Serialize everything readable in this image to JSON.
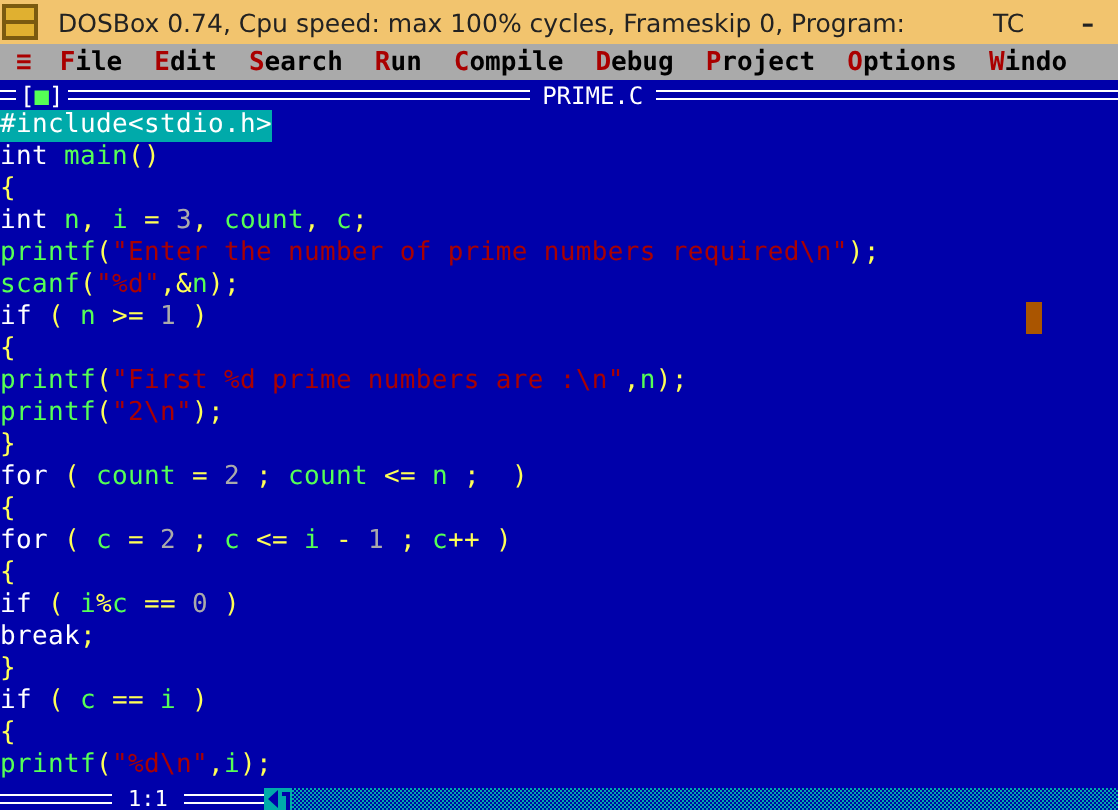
{
  "window": {
    "title": "DOSBox 0.74, Cpu speed: max 100% cycles, Frameskip  0, Program:",
    "program": "TC",
    "minimize": "–"
  },
  "menu": {
    "system": "≡",
    "items": [
      "File",
      "Edit",
      "Search",
      "Run",
      "Compile",
      "Debug",
      "Project",
      "Options",
      "Windo"
    ]
  },
  "editor": {
    "close_box": "[■]",
    "title": "PRIME.C",
    "lines": [
      {
        "selected": true,
        "tokens": [
          {
            "kind": "pre",
            "text": "#include<stdio.h>"
          }
        ]
      },
      {
        "selected": false,
        "tokens": [
          {
            "kind": "kw",
            "text": "int "
          },
          {
            "kind": "id",
            "text": "main"
          },
          {
            "kind": "pu",
            "text": "()"
          }
        ]
      },
      {
        "selected": false,
        "tokens": [
          {
            "kind": "pu",
            "text": "{"
          }
        ]
      },
      {
        "selected": false,
        "tokens": [
          {
            "kind": "kw",
            "text": "int "
          },
          {
            "kind": "id",
            "text": "n"
          },
          {
            "kind": "pu",
            "text": ", "
          },
          {
            "kind": "id",
            "text": "i "
          },
          {
            "kind": "pu",
            "text": "= "
          },
          {
            "kind": "num",
            "text": "3"
          },
          {
            "kind": "pu",
            "text": ", "
          },
          {
            "kind": "id",
            "text": "count"
          },
          {
            "kind": "pu",
            "text": ", "
          },
          {
            "kind": "id",
            "text": "c"
          },
          {
            "kind": "pu",
            "text": ";"
          }
        ]
      },
      {
        "selected": false,
        "tokens": [
          {
            "kind": "id",
            "text": "printf"
          },
          {
            "kind": "pu",
            "text": "("
          },
          {
            "kind": "str",
            "text": "\"Enter the number of prime numbers required\\n\""
          },
          {
            "kind": "pu",
            "text": ");"
          }
        ]
      },
      {
        "selected": false,
        "tokens": [
          {
            "kind": "id",
            "text": "scanf"
          },
          {
            "kind": "pu",
            "text": "("
          },
          {
            "kind": "str",
            "text": "\"%d\""
          },
          {
            "kind": "pu",
            "text": ",&"
          },
          {
            "kind": "id",
            "text": "n"
          },
          {
            "kind": "pu",
            "text": ");"
          }
        ]
      },
      {
        "selected": false,
        "cursor": true,
        "tokens": [
          {
            "kind": "kw",
            "text": "if "
          },
          {
            "kind": "pu",
            "text": "( "
          },
          {
            "kind": "id",
            "text": "n "
          },
          {
            "kind": "pu",
            "text": ">= "
          },
          {
            "kind": "num",
            "text": "1 "
          },
          {
            "kind": "pu",
            "text": ")"
          }
        ]
      },
      {
        "selected": false,
        "tokens": [
          {
            "kind": "pu",
            "text": "{"
          }
        ]
      },
      {
        "selected": false,
        "tokens": [
          {
            "kind": "id",
            "text": "printf"
          },
          {
            "kind": "pu",
            "text": "("
          },
          {
            "kind": "str",
            "text": "\"First %d prime numbers are :\\n\""
          },
          {
            "kind": "pu",
            "text": ","
          },
          {
            "kind": "id",
            "text": "n"
          },
          {
            "kind": "pu",
            "text": ");"
          }
        ]
      },
      {
        "selected": false,
        "tokens": [
          {
            "kind": "id",
            "text": "printf"
          },
          {
            "kind": "pu",
            "text": "("
          },
          {
            "kind": "str",
            "text": "\"2\\n\""
          },
          {
            "kind": "pu",
            "text": ");"
          }
        ]
      },
      {
        "selected": false,
        "tokens": [
          {
            "kind": "pu",
            "text": "}"
          }
        ]
      },
      {
        "selected": false,
        "tokens": [
          {
            "kind": "kw",
            "text": "for "
          },
          {
            "kind": "pu",
            "text": "( "
          },
          {
            "kind": "id",
            "text": "count "
          },
          {
            "kind": "pu",
            "text": "= "
          },
          {
            "kind": "num",
            "text": "2 "
          },
          {
            "kind": "pu",
            "text": "; "
          },
          {
            "kind": "id",
            "text": "count "
          },
          {
            "kind": "pu",
            "text": "<= "
          },
          {
            "kind": "id",
            "text": "n "
          },
          {
            "kind": "pu",
            "text": ";  )"
          }
        ]
      },
      {
        "selected": false,
        "tokens": [
          {
            "kind": "pu",
            "text": "{"
          }
        ]
      },
      {
        "selected": false,
        "tokens": [
          {
            "kind": "kw",
            "text": "for "
          },
          {
            "kind": "pu",
            "text": "( "
          },
          {
            "kind": "id",
            "text": "c "
          },
          {
            "kind": "pu",
            "text": "= "
          },
          {
            "kind": "num",
            "text": "2 "
          },
          {
            "kind": "pu",
            "text": "; "
          },
          {
            "kind": "id",
            "text": "c "
          },
          {
            "kind": "pu",
            "text": "<= "
          },
          {
            "kind": "id",
            "text": "i "
          },
          {
            "kind": "pu",
            "text": "- "
          },
          {
            "kind": "num",
            "text": "1 "
          },
          {
            "kind": "pu",
            "text": "; "
          },
          {
            "kind": "id",
            "text": "c"
          },
          {
            "kind": "pu",
            "text": "++ )"
          }
        ]
      },
      {
        "selected": false,
        "tokens": [
          {
            "kind": "pu",
            "text": "{"
          }
        ]
      },
      {
        "selected": false,
        "tokens": [
          {
            "kind": "kw",
            "text": "if "
          },
          {
            "kind": "pu",
            "text": "( "
          },
          {
            "kind": "id",
            "text": "i"
          },
          {
            "kind": "pu",
            "text": "%"
          },
          {
            "kind": "id",
            "text": "c "
          },
          {
            "kind": "pu",
            "text": "== "
          },
          {
            "kind": "num",
            "text": "0 "
          },
          {
            "kind": "pu",
            "text": ")"
          }
        ]
      },
      {
        "selected": false,
        "tokens": [
          {
            "kind": "kw",
            "text": "break"
          },
          {
            "kind": "pu",
            "text": ";"
          }
        ]
      },
      {
        "selected": false,
        "tokens": [
          {
            "kind": "pu",
            "text": "}"
          }
        ]
      },
      {
        "selected": false,
        "tokens": [
          {
            "kind": "kw",
            "text": "if "
          },
          {
            "kind": "pu",
            "text": "( "
          },
          {
            "kind": "id",
            "text": "c "
          },
          {
            "kind": "pu",
            "text": "== "
          },
          {
            "kind": "id",
            "text": "i "
          },
          {
            "kind": "pu",
            "text": ")"
          }
        ]
      },
      {
        "selected": false,
        "tokens": [
          {
            "kind": "pu",
            "text": "{"
          }
        ]
      },
      {
        "selected": false,
        "tokens": [
          {
            "kind": "id",
            "text": "printf"
          },
          {
            "kind": "pu",
            "text": "("
          },
          {
            "kind": "str",
            "text": "\"%d\\n\""
          },
          {
            "kind": "pu",
            "text": ","
          },
          {
            "kind": "id",
            "text": "i"
          },
          {
            "kind": "pu",
            "text": ");"
          }
        ]
      }
    ],
    "position": "1:1"
  }
}
